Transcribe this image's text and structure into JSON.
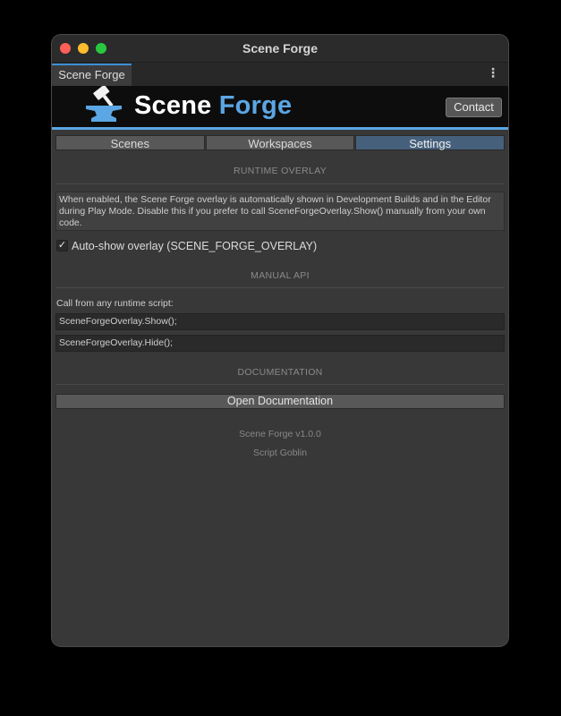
{
  "window": {
    "title": "Scene Forge"
  },
  "tab": {
    "label": "Scene Forge",
    "menu_glyph": "⋮"
  },
  "banner": {
    "logo_word1": "Scene",
    "logo_word2": "Forge",
    "contact_label": "Contact"
  },
  "toolbar": {
    "tabs": [
      "Scenes",
      "Workspaces",
      "Settings"
    ],
    "active": "Settings"
  },
  "runtime_overlay": {
    "header": "RUNTIME OVERLAY",
    "help_text": "When enabled, the Scene Forge overlay is automatically shown in Development Builds and in the Editor during Play Mode. Disable this if you prefer to call SceneForgeOverlay.Show() manually from your own code.",
    "toggle_label": "Auto-show overlay (SCENE_FORGE_OVERLAY)",
    "toggle_checked": true,
    "check_glyph": "✓"
  },
  "manual_api": {
    "header": "MANUAL API",
    "label": "Call from any runtime script:",
    "show_call": "SceneForgeOverlay.Show();",
    "hide_call": "SceneForgeOverlay.Hide();"
  },
  "documentation": {
    "header": "DOCUMENTATION",
    "button_label": "Open Documentation"
  },
  "footer": {
    "version": "Scene Forge v1.0.0",
    "author": "Script Goblin"
  },
  "colors": {
    "accent": "#5ba6e4",
    "active_tab": "#46607c",
    "panel_bg": "#383838",
    "banner_bg": "#0d0d0d"
  },
  "icons": {
    "window_controls": [
      "close-icon",
      "minimize-icon",
      "maximize-icon"
    ],
    "logo": "hammer-anvil-icon",
    "tab_menu": "kebab-menu-icon"
  }
}
